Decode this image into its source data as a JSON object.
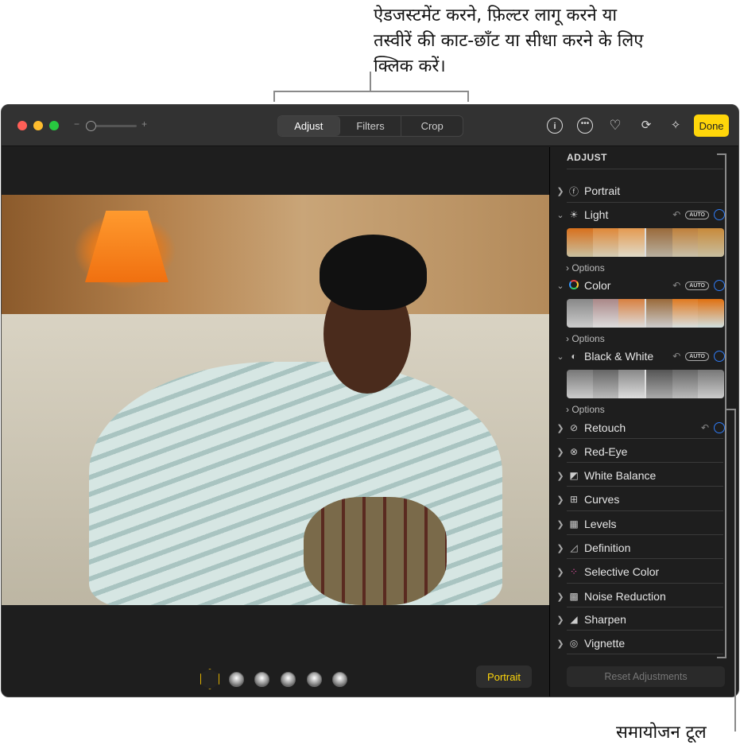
{
  "callouts": {
    "top": "ऐडजस्टमेंट करने, फ़िल्टर लागू करने या तस्वीरें की काट-छाँट या सीधा करने के लिए क्लिक करें।",
    "right": "समायोजन टूल"
  },
  "toolbar": {
    "tabs": [
      "Adjust",
      "Filters",
      "Crop"
    ],
    "active_tab": "Adjust",
    "zoom_minus": "−",
    "zoom_plus": "+",
    "done": "Done",
    "icons": [
      "info-icon",
      "more-icon",
      "heart-icon",
      "rotate-icon",
      "magic-wand-icon"
    ]
  },
  "viewer": {
    "portrait_button": "Portrait",
    "lighting_options": 6
  },
  "sidebar": {
    "title": "ADJUST",
    "sections": [
      {
        "label": "Portrait",
        "icon": "f-stop-icon",
        "expanded": false
      },
      {
        "label": "Light",
        "icon": "sun-icon",
        "expanded": true,
        "auto": "AUTO",
        "options": "Options"
      },
      {
        "label": "Color",
        "icon": "color-ring-icon",
        "expanded": true,
        "auto": "AUTO",
        "options": "Options"
      },
      {
        "label": "Black & White",
        "icon": "half-circle-icon",
        "expanded": true,
        "auto": "AUTO",
        "options": "Options"
      },
      {
        "label": "Retouch",
        "icon": "bandage-icon"
      },
      {
        "label": "Red-Eye",
        "icon": "eye-icon"
      },
      {
        "label": "White Balance",
        "icon": "white-balance-icon"
      },
      {
        "label": "Curves",
        "icon": "curves-icon"
      },
      {
        "label": "Levels",
        "icon": "levels-icon"
      },
      {
        "label": "Definition",
        "icon": "triangle-icon"
      },
      {
        "label": "Selective Color",
        "icon": "dots-icon"
      },
      {
        "label": "Noise Reduction",
        "icon": "noise-icon"
      },
      {
        "label": "Sharpen",
        "icon": "sharpen-icon"
      },
      {
        "label": "Vignette",
        "icon": "vignette-icon"
      }
    ],
    "reset": "Reset Adjustments"
  },
  "colors": {
    "accent_yellow": "#ffd60a",
    "toggle_blue": "#2f7bf5"
  }
}
